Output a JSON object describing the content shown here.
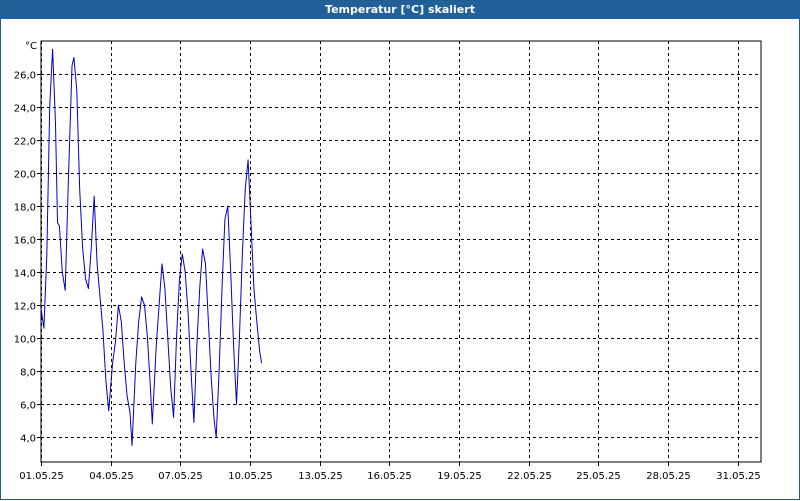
{
  "window": {
    "title": "Temperatur [°C] skaliert"
  },
  "colors": {
    "titlebar": "#21609a",
    "line": "#0000cc",
    "grid": "#000000"
  },
  "chart_data": {
    "type": "line",
    "title": "Temperatur [°C] skaliert",
    "ylabel": "°C",
    "xlabel": "",
    "grid": true,
    "xlim": [
      "01.05.25",
      "01.06.25"
    ],
    "ylim": [
      2.5,
      28.0
    ],
    "yticks": [
      "4,0",
      "6,0",
      "8,0",
      "10,0",
      "12,0",
      "14,0",
      "16,0",
      "18,0",
      "20,0",
      "22,0",
      "24,0",
      "26,0"
    ],
    "xticks": [
      "01.05.25",
      "04.05.25",
      "07.05.25",
      "10.05.25",
      "13.05.25",
      "16.05.25",
      "19.05.25",
      "22.05.25",
      "25.05.25",
      "28.05.25",
      "31.05.25"
    ],
    "series": [
      {
        "values": [
          [
            "01.05.25 00:00",
            11.8
          ],
          [
            "01.05.25 03:00",
            10.6
          ],
          [
            "01.05.25 06:00",
            15.0
          ],
          [
            "01.05.25 09:00",
            24.0
          ],
          [
            "01.05.25 12:00",
            27.5
          ],
          [
            "01.05.25 15:00",
            23.0
          ],
          [
            "01.05.25 17:00",
            17.0
          ],
          [
            "01.05.25 19:00",
            16.8
          ],
          [
            "01.05.25 22:00",
            14.0
          ],
          [
            "02.05.25 01:00",
            12.9
          ],
          [
            "02.05.25 04:00",
            19.0
          ],
          [
            "02.05.25 08:00",
            26.5
          ],
          [
            "02.05.25 10:00",
            27.0
          ],
          [
            "02.05.25 13:00",
            25.0
          ],
          [
            "02.05.25 16:00",
            19.0
          ],
          [
            "02.05.25 19:00",
            15.5
          ],
          [
            "02.05.25 22:00",
            13.6
          ],
          [
            "03.05.25 01:00",
            13.0
          ],
          [
            "03.05.25 04:00",
            15.5
          ],
          [
            "03.05.25 07:00",
            18.6
          ],
          [
            "03.05.25 10:00",
            14.5
          ],
          [
            "03.05.25 13:00",
            12.5
          ],
          [
            "03.05.25 16:00",
            10.5
          ],
          [
            "03.05.25 19:00",
            7.5
          ],
          [
            "03.05.25 22:00",
            5.6
          ],
          [
            "04.05.25 02:00",
            8.5
          ],
          [
            "04.05.25 05:00",
            9.8
          ],
          [
            "04.05.25 08:00",
            12.0
          ],
          [
            "04.05.25 11:00",
            11.0
          ],
          [
            "04.05.25 14:00",
            8.5
          ],
          [
            "04.05.25 17:00",
            6.5
          ],
          [
            "04.05.25 20:00",
            5.5
          ],
          [
            "04.05.25 22:00",
            3.5
          ],
          [
            "05.05.25 02:00",
            8.5
          ],
          [
            "05.05.25 05:00",
            11.0
          ],
          [
            "05.05.25 08:00",
            12.5
          ],
          [
            "05.05.25 11:00",
            12.0
          ],
          [
            "05.05.25 14:00",
            10.0
          ],
          [
            "05.05.25 17:00",
            7.0
          ],
          [
            "05.05.25 19:00",
            4.8
          ],
          [
            "05.05.25 23:00",
            9.5
          ],
          [
            "06.05.25 02:00",
            12.0
          ],
          [
            "06.05.25 05:00",
            14.5
          ],
          [
            "06.05.25 08:00",
            13.0
          ],
          [
            "06.05.25 11:00",
            10.0
          ],
          [
            "06.05.25 14:00",
            7.0
          ],
          [
            "06.05.25 17:00",
            5.2
          ],
          [
            "06.05.25 20:00",
            10.0
          ],
          [
            "06.05.25 23:00",
            13.5
          ],
          [
            "07.05.25 02:00",
            15.1
          ],
          [
            "07.05.25 05:00",
            14.0
          ],
          [
            "07.05.25 08:00",
            11.5
          ],
          [
            "07.05.25 11:00",
            8.0
          ],
          [
            "07.05.25 14:00",
            4.9
          ],
          [
            "07.05.25 17:00",
            9.5
          ],
          [
            "07.05.25 20:00",
            13.0
          ],
          [
            "07.05.25 23:00",
            15.4
          ],
          [
            "08.05.25 02:00",
            14.5
          ],
          [
            "08.05.25 05:00",
            11.0
          ],
          [
            "08.05.25 08:00",
            7.5
          ],
          [
            "08.05.25 11:00",
            5.0
          ],
          [
            "08.05.25 13:00",
            4.0
          ],
          [
            "08.05.25 16:00",
            8.0
          ],
          [
            "08.05.25 19:00",
            13.0
          ],
          [
            "08.05.25 22:00",
            17.2
          ],
          [
            "09.05.25 01:00",
            18.0
          ],
          [
            "09.05.25 04:00",
            14.0
          ],
          [
            "09.05.25 07:00",
            9.5
          ],
          [
            "09.05.25 10:00",
            6.0
          ],
          [
            "09.05.25 13:00",
            10.0
          ],
          [
            "09.05.25 16:00",
            15.0
          ],
          [
            "09.05.25 19:00",
            19.0
          ],
          [
            "09.05.25 22:00",
            20.8
          ],
          [
            "10.05.25 01:00",
            17.0
          ],
          [
            "10.05.25 04:00",
            13.0
          ],
          [
            "10.05.25 07:00",
            11.0
          ],
          [
            "10.05.25 10:00",
            9.2
          ],
          [
            "10.05.25 12:00",
            8.5
          ]
        ]
      }
    ]
  }
}
